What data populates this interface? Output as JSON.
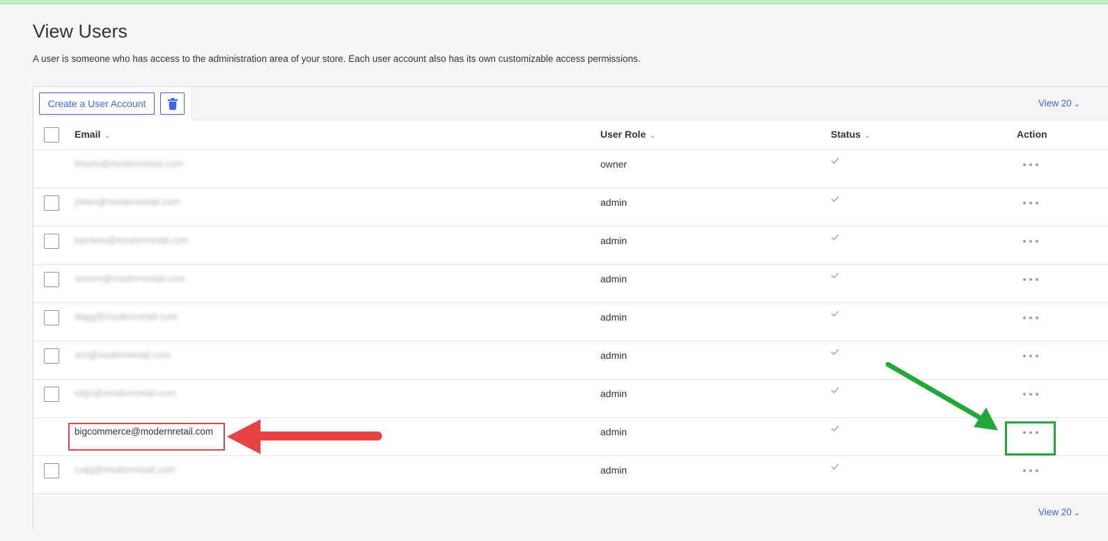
{
  "page": {
    "title": "View Users",
    "description": "A user is someone who has access to the administration area of your store. Each user account also has its own customizable access permissions."
  },
  "toolbar": {
    "create_label": "Create a User Account",
    "view_label": "View 20"
  },
  "table": {
    "columns": [
      "Email",
      "User Role",
      "Status",
      "Action"
    ],
    "rows": [
      {
        "email": "tmunn@modernretail.com",
        "role": "owner",
        "selectable": false,
        "blurred": true
      },
      {
        "email": "jrelen@modernretail.com",
        "role": "admin",
        "selectable": true,
        "blurred": true
      },
      {
        "email": "bjenkes@modernretail.com",
        "role": "admin",
        "selectable": true,
        "blurred": true
      },
      {
        "email": "smunn@modernretail.com",
        "role": "admin",
        "selectable": true,
        "blurred": true
      },
      {
        "email": "dagg@modernretail.com",
        "role": "admin",
        "selectable": true,
        "blurred": true
      },
      {
        "email": "arn@modernretail.com",
        "role": "admin",
        "selectable": true,
        "blurred": true
      },
      {
        "email": "rdgo@modernretail.com",
        "role": "admin",
        "selectable": true,
        "blurred": true
      },
      {
        "email": "bigcommerce@modernretail.com",
        "role": "admin",
        "selectable": false,
        "blurred": false
      },
      {
        "email": "ruag@modernretail.com",
        "role": "admin",
        "selectable": true,
        "blurred": true
      }
    ]
  },
  "footer": {
    "view_label": "View 20"
  },
  "icons": {
    "trash": "trash-icon",
    "checkmark": "checkmark-icon",
    "more": "more-dots-icon",
    "sort": "chevron-down-icon"
  },
  "colors": {
    "accent": "#3c64f4",
    "annotation_red": "#e64242",
    "annotation_green": "#21a838"
  }
}
